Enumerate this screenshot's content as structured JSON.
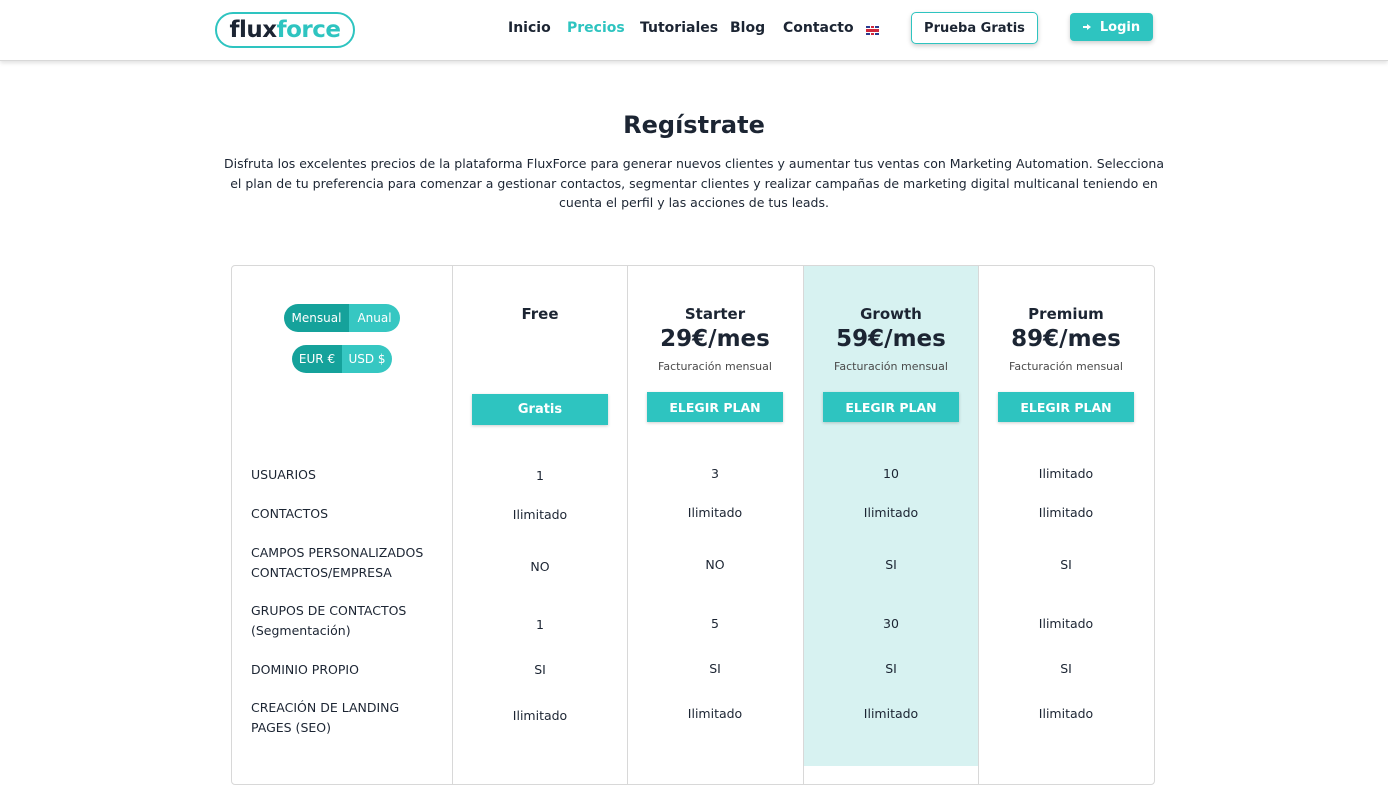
{
  "header": {
    "logo": {
      "part1": "flux",
      "part2": "force"
    },
    "nav": [
      "Inicio",
      "Precios",
      "Tutoriales",
      "Blog",
      "Contacto"
    ],
    "active_nav": "Precios",
    "language_icon": "uk-flag-icon",
    "trial_label": "Prueba Gratis",
    "login_label": "Login"
  },
  "hero": {
    "title": "Regístrate",
    "subtitle": "Disfruta los excelentes precios de la plataforma FluxForce para generar nuevos clientes y aumentar tus ventas con Marketing Automation. Selecciona el plan de tu preferencia para comenzar a gestionar contactos, segmentar clientes y realizar campañas de marketing digital multicanal teniendo en cuenta el perfil y las acciones de tus leads."
  },
  "toggles": {
    "billing": {
      "monthly": "Mensual",
      "annual": "Anual"
    },
    "currency": {
      "eur": "EUR €",
      "usd": "USD $"
    }
  },
  "plans": [
    {
      "name": "Free",
      "price": "",
      "billing": "",
      "button": "Gratis"
    },
    {
      "name": "Starter",
      "price": "29€/mes",
      "billing": "Facturación mensual",
      "button": "ELEGIR PLAN"
    },
    {
      "name": "Growth",
      "price": "59€/mes",
      "billing": "Facturación mensual",
      "button": "ELEGIR PLAN"
    },
    {
      "name": "Premium",
      "price": "89€/mes",
      "billing": "Facturación mensual",
      "button": "ELEGIR PLAN"
    }
  ],
  "features": [
    {
      "label": "USUARIOS",
      "values": [
        "1",
        "3",
        "10",
        "Ilimitado"
      ]
    },
    {
      "label": "CONTACTOS",
      "values": [
        "Ilimitado",
        "Ilimitado",
        "Ilimitado",
        "Ilimitado"
      ]
    },
    {
      "label": "CAMPOS PERSONALIZADOS CONTACTOS/EMPRESA",
      "values": [
        "NO",
        "NO",
        "SI",
        "SI"
      ]
    },
    {
      "label": "GRUPOS DE CONTACTOS (Segmentación)",
      "values": [
        "1",
        "5",
        "30",
        "Ilimitado"
      ]
    },
    {
      "label": "DOMINIO PROPIO",
      "values": [
        "SI",
        "SI",
        "SI",
        "SI"
      ]
    },
    {
      "label": "CREACIÓN DE LANDING PAGES (SEO)",
      "values": [
        "Ilimitado",
        "Ilimitado",
        "Ilimitado",
        "Ilimitado"
      ]
    }
  ],
  "colors": {
    "accent": "#2ec4c0",
    "accent_dark": "#15a29b",
    "highlight": "#d7f2f1",
    "text": "#1c2533"
  }
}
